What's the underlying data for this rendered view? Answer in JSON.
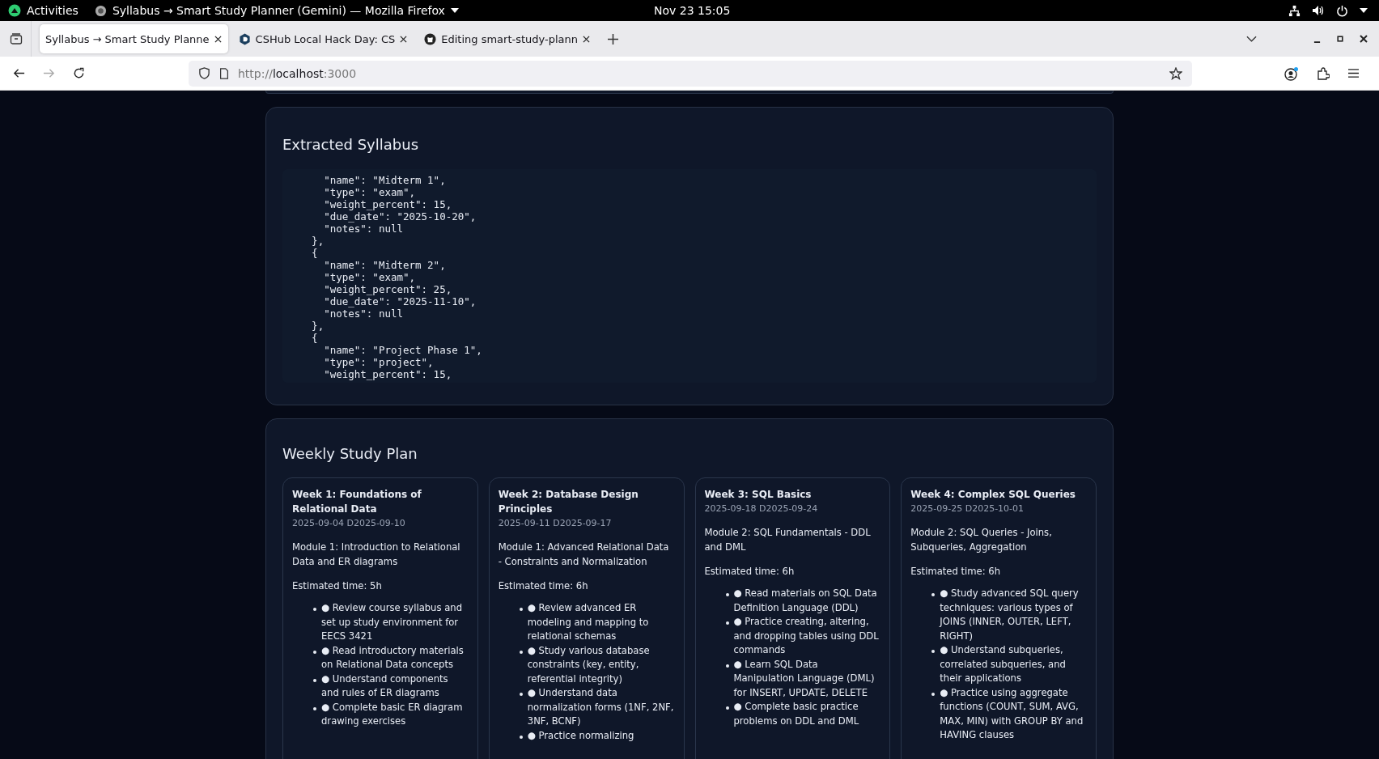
{
  "top_bar": {
    "activities": "Activities",
    "app_title": "Syllabus → Smart Study Planner (Gemini) — Mozilla Firefox",
    "clock": "Nov 23  15:05"
  },
  "tabs": [
    {
      "title": "Syllabus → Smart Study Planne",
      "selected": true
    },
    {
      "title": "CSHub Local Hack Day: CS",
      "selected": false
    },
    {
      "title": "Editing smart-study-plann",
      "selected": false
    }
  ],
  "address": {
    "scheme": "http://",
    "host": "localhost",
    "port": ":3000"
  },
  "forward_disabled": true,
  "syllabus": {
    "title": "Extracted Syllabus",
    "code_lines": [
      "      \"name\": \"Midterm 1\",",
      "      \"type\": \"exam\",",
      "      \"weight_percent\": 15,",
      "      \"due_date\": \"2025-10-20\",",
      "      \"notes\": null",
      "    },",
      "    {",
      "      \"name\": \"Midterm 2\",",
      "      \"type\": \"exam\",",
      "      \"weight_percent\": 25,",
      "      \"due_date\": \"2025-11-10\",",
      "      \"notes\": null",
      "    },",
      "    {",
      "      \"name\": \"Project Phase 1\",",
      "      \"type\": \"project\",",
      "      \"weight_percent\": 15,"
    ]
  },
  "plan": {
    "title": "Weekly Study Plan",
    "weeks": [
      {
        "title": "Week 1: Foundations of Relational Data",
        "dates": "2025-09-04 D2025-09-10",
        "module": "Module 1: Introduction to Relational Data and ER diagrams",
        "time": "Estimated time: 5h",
        "tasks": [
          "● Review course syllabus and set up study environment for EECS 3421",
          "● Read introductory materials on Relational Data concepts",
          "● Understand components and rules of ER diagrams",
          "● Complete basic ER diagram drawing exercises"
        ]
      },
      {
        "title": "Week 2: Database Design Principles",
        "dates": "2025-09-11 D2025-09-17",
        "module": "Module 1: Advanced Relational Data - Constraints and Normalization",
        "time": "Estimated time: 6h",
        "tasks": [
          "● Review advanced ER modeling and mapping to relational schemas",
          "● Study various database constraints (key, entity, referential integrity)",
          "● Understand data normalization forms (1NF, 2NF, 3NF, BCNF)",
          "● Practice normalizing"
        ]
      },
      {
        "title": "Week 3: SQL Basics",
        "dates": "2025-09-18 D2025-09-24",
        "module": "Module 2: SQL Fundamentals - DDL and DML",
        "time": "Estimated time: 6h",
        "tasks": [
          "● Read materials on SQL Data Definition Language (DDL)",
          "● Practice creating, altering, and dropping tables using DDL commands",
          "● Learn SQL Data Manipulation Language (DML) for INSERT, UPDATE, DELETE",
          "● Complete basic practice problems on DDL and DML"
        ]
      },
      {
        "title": "Week 4: Complex SQL Queries",
        "dates": "2025-09-25 D2025-10-01",
        "module": "Module 2: SQL Queries - Joins, Subqueries, Aggregation",
        "time": "Estimated time: 6h",
        "tasks": [
          "● Study advanced SQL query techniques: various types of JOINS (INNER, OUTER, LEFT, RIGHT)",
          "● Understand subqueries, correlated subqueries, and their applications",
          "● Practice using aggregate functions (COUNT, SUM, AVG, MAX, MIN) with GROUP BY and HAVING clauses"
        ]
      }
    ]
  }
}
